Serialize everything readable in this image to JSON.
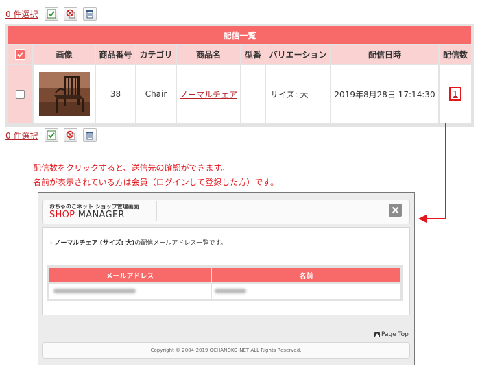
{
  "toolbar": {
    "select_count_label": "0 件選択"
  },
  "list": {
    "title": "配信一覧",
    "headers": {
      "image": "画像",
      "product_number": "商品番号",
      "category": "カテゴリ",
      "product_name": "商品名",
      "model": "型番",
      "variation": "バリエーション",
      "date": "配信日時",
      "count": "配信数"
    },
    "row": {
      "image_alt": "chair-photo",
      "product_number": "38",
      "category": "Chair",
      "product_name": "ノーマルチェア",
      "model": "",
      "variation": "サイズ: 大",
      "date": "2019年8月28日 17:14:30",
      "count": "1"
    }
  },
  "note": {
    "line1": "配信数をクリックすると、送信先の確認ができます。",
    "line2": "名前が表示されている方は会員（ログインして登録した方）です。"
  },
  "popup": {
    "brand_sub": "おちゃのこネット ショップ管理画面",
    "brand_accent": "SHOP",
    "brand_rest": " MANAGER",
    "crumb_bold": "ノーマルチェア (サイズ: 大)",
    "crumb_rest": "の配信メールアドレス一覧です。",
    "col_email": "メールアドレス",
    "col_name": "名前",
    "page_top": "Page Top",
    "copyright": "Copyright © 2004-2019 OCHANOKO-NET ALL Rights Reserved."
  },
  "colors": {
    "accent": "#f86a6a",
    "header_bg": "#fbd2d2",
    "link": "#b3262a",
    "annotation": "#e3161b"
  }
}
